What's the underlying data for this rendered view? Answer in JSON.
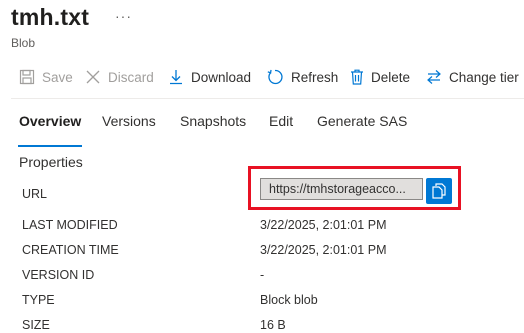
{
  "header": {
    "title": "tmh.txt",
    "more_label": "···",
    "subtitle": "Blob"
  },
  "toolbar": {
    "save_label": "Save",
    "discard_label": "Discard",
    "download_label": "Download",
    "refresh_label": "Refresh",
    "delete_label": "Delete",
    "change_tier_label": "Change tier"
  },
  "tabs": {
    "overview": "Overview",
    "versions": "Versions",
    "snapshots": "Snapshots",
    "edit": "Edit",
    "generate_sas": "Generate SAS",
    "active": "Overview"
  },
  "properties": {
    "heading": "Properties",
    "url_label": "URL",
    "url_value": "https://tmhstorageacco...",
    "last_modified_label": "LAST MODIFIED",
    "last_modified_value": "3/22/2025, 2:01:01 PM",
    "creation_time_label": "CREATION TIME",
    "creation_time_value": "3/22/2025, 2:01:01 PM",
    "version_id_label": "VERSION ID",
    "version_id_value": "-",
    "type_label": "TYPE",
    "type_value": "Block blob",
    "size_label": "SIZE",
    "size_value": "16 B"
  },
  "colors": {
    "accent": "#0078d4",
    "highlight": "#e81123",
    "disabled": "#a19f9d"
  },
  "icons": [
    "save-icon",
    "discard-icon",
    "download-icon",
    "refresh-icon",
    "delete-icon",
    "change-tier-icon",
    "copy-icon"
  ]
}
